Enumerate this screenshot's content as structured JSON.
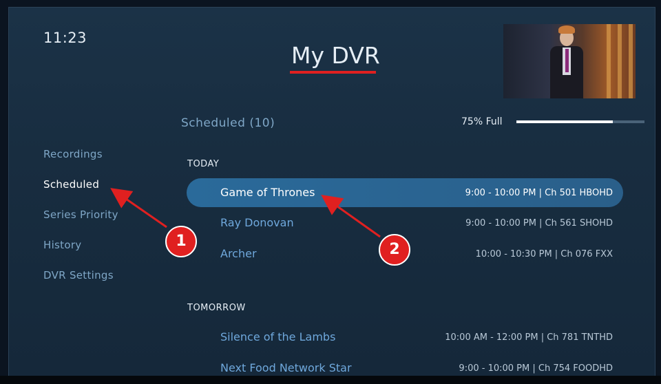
{
  "header": {
    "clock": "11:23",
    "title": "My DVR"
  },
  "preview": {
    "description_icon": "live-tv-preview"
  },
  "summary": {
    "scheduled_label": "Scheduled (10)",
    "storage_label": "75% Full",
    "storage_fraction": 0.75
  },
  "sidebar": {
    "items": [
      {
        "label": "Recordings",
        "active": false
      },
      {
        "label": "Scheduled",
        "active": true
      },
      {
        "label": "Series Priority",
        "active": false
      },
      {
        "label": "History",
        "active": false
      },
      {
        "label": "DVR Settings",
        "active": false
      }
    ]
  },
  "sections": [
    {
      "label": "TODAY",
      "rows": [
        {
          "show": "Game of Thrones",
          "info": "9:00 - 10:00 PM | Ch 501 HBOHD",
          "selected": true
        },
        {
          "show": "Ray Donovan",
          "info": "9:00 - 10:00 PM | Ch 561 SHOHD",
          "selected": false
        },
        {
          "show": "Archer",
          "info": "10:00 - 10:30 PM | Ch 076 FXX",
          "selected": false
        }
      ]
    },
    {
      "label": "TOMORROW",
      "rows": [
        {
          "show": "Silence of the Lambs",
          "info": "10:00 AM - 12:00 PM | Ch 781 TNTHD",
          "selected": false
        },
        {
          "show": "Next Food Network Star",
          "info": "9:00 - 10:00 PM | Ch 754 FOODHD",
          "selected": false
        }
      ]
    }
  ],
  "annotations": {
    "badge1": "1",
    "badge2": "2",
    "color": "#e02020"
  }
}
